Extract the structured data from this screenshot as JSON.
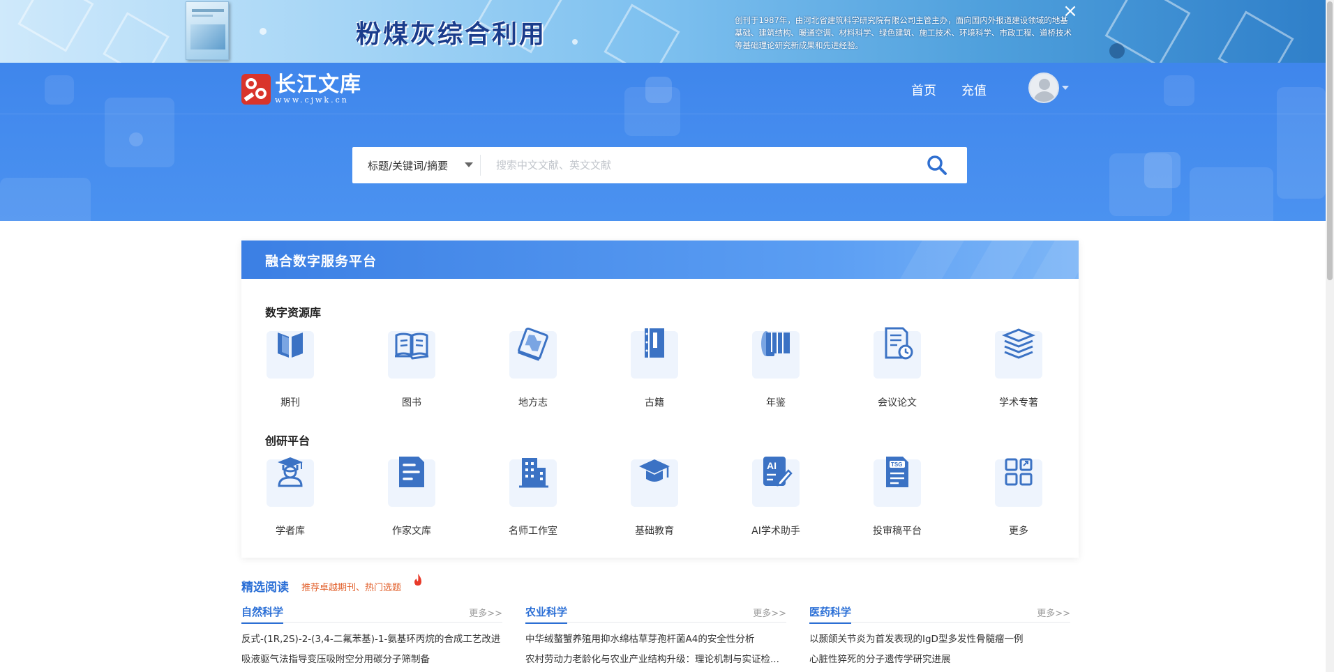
{
  "banner": {
    "title": "粉煤灰综合利用",
    "description": "创刊于1987年，由河北省建筑科学研究院有限公司主管主办，面向国内外报道建设领域的地基基础、建筑结构、暖通空调、材料科学、绿色建筑、施工技术、环境科学、市政工程、道桥技术等基础理论研究新成果和先进经验。",
    "close_icon": "close-icon"
  },
  "header": {
    "logo_name": "长江文库",
    "logo_url": "www.cjwk.cn",
    "nav": [
      "首页",
      "充值"
    ],
    "avatar_icon": "user-avatar-icon"
  },
  "search": {
    "field_label": "标题/关键词/摘要",
    "placeholder": "搜索中文文献、英文文献",
    "button_icon": "search-icon"
  },
  "platform": {
    "title": "融合数字服务平台",
    "sections": [
      {
        "label": "数字资源库",
        "items": [
          {
            "label": "期刊",
            "icon": "journal-icon"
          },
          {
            "label": "图书",
            "icon": "book-icon"
          },
          {
            "label": "地方志",
            "icon": "gazetteer-icon"
          },
          {
            "label": "古籍",
            "icon": "ancient-book-icon"
          },
          {
            "label": "年鉴",
            "icon": "yearbook-icon"
          },
          {
            "label": "会议论文",
            "icon": "conference-paper-icon"
          },
          {
            "label": "学术专著",
            "icon": "monograph-icon"
          }
        ]
      },
      {
        "label": "创研平台",
        "items": [
          {
            "label": "学者库",
            "icon": "scholar-icon"
          },
          {
            "label": "作家文库",
            "icon": "writer-library-icon"
          },
          {
            "label": "名师工作室",
            "icon": "teacher-studio-icon"
          },
          {
            "label": "基础教育",
            "icon": "education-icon"
          },
          {
            "label": "AI学术助手",
            "icon": "ai-assistant-icon"
          },
          {
            "label": "投审稿平台",
            "icon": "submission-icon"
          },
          {
            "label": "更多",
            "icon": "more-grid-icon"
          }
        ]
      }
    ]
  },
  "featured": {
    "title": "精选阅读",
    "subtitle": "推荐卓越期刊、热门选题",
    "columns": [
      {
        "name": "自然科学",
        "more": "更多>>",
        "items": [
          "反式-(1R,2S)-2-(3,4-二氟苯基)-1-氨基环丙烷的合成工艺改进",
          "吸液驱气法指导变压吸附空分用碳分子筛制备"
        ]
      },
      {
        "name": "农业科学",
        "more": "更多>>",
        "items": [
          "中华绒螯蟹养殖用抑水绵枯草芽孢杆菌A4的安全性分析",
          "农村劳动力老龄化与农业产业结构升级：理论机制与实证检..."
        ]
      },
      {
        "name": "医药科学",
        "more": "更多>>",
        "items": [
          "以颞颌关节炎为首发表现的IgD型多发性骨髓瘤一例",
          "心脏性猝死的分子遗传学研究进展"
        ]
      }
    ]
  },
  "colors": {
    "header_blue": "#3f86ec",
    "accent_blue": "#2b6fd6",
    "icon_blue": "#3b72c4",
    "highlight_orange": "#e2622e"
  }
}
